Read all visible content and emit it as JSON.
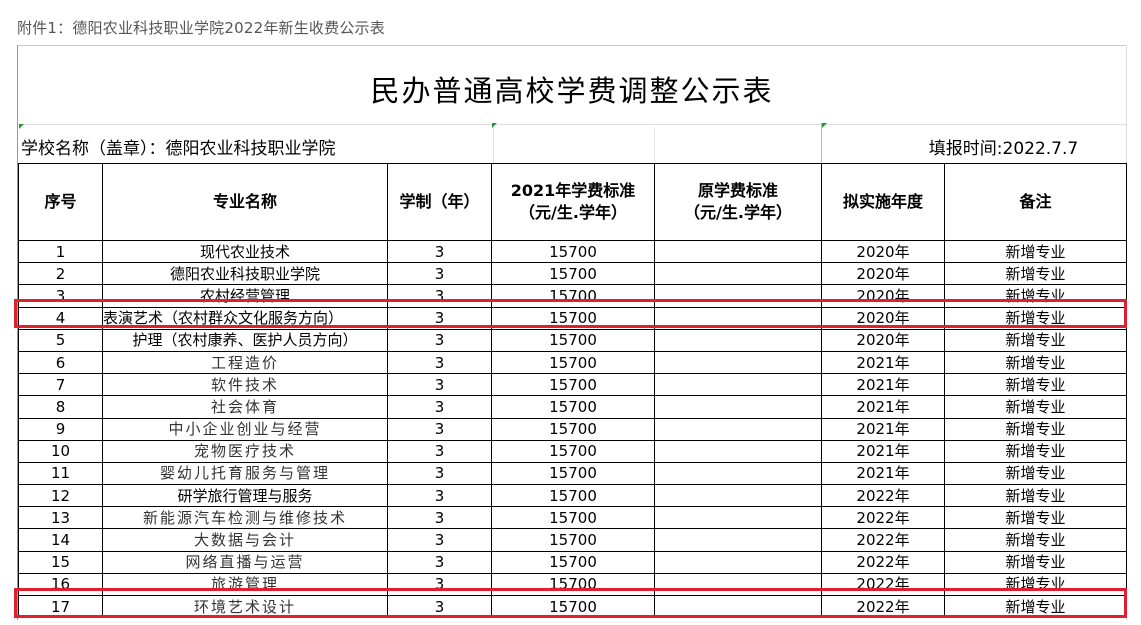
{
  "caption": "附件1：德阳农业科技职业学院2022年新生收费公示表",
  "title": "民办普通高校学费调整公示表",
  "school_label": "学校名称（盖章）：德阳农业科技职业学院",
  "fill_date": "填报时间:2022.7.7",
  "headers": {
    "seq": "序号",
    "major": "专业名称",
    "years": "学制（年）",
    "fee2021_line1": "2021年学费标准",
    "fee2021_line2": "（元/生.学年）",
    "orig_line1": "原学费标准",
    "orig_line2": "（元/生.学年）",
    "impl_year": "拟实施年度",
    "remark": "备注"
  },
  "rows": [
    {
      "seq": "1",
      "major": "现代农业技术",
      "years": "3",
      "fee": "15700",
      "orig": "",
      "year": "2020年",
      "remark": "新增专业"
    },
    {
      "seq": "2",
      "major": "德阳农业科技职业学院",
      "years": "3",
      "fee": "15700",
      "orig": "",
      "year": "2020年",
      "remark": "新增专业"
    },
    {
      "seq": "3",
      "major": "农村经营管理",
      "years": "3",
      "fee": "15700",
      "orig": "",
      "year": "2020年",
      "remark": "新增专业"
    },
    {
      "seq": "4",
      "major": "表演艺术（农村群众文化服务方向）",
      "years": "3",
      "fee": "15700",
      "orig": "",
      "year": "2020年",
      "remark": "新增专业"
    },
    {
      "seq": "5",
      "major": "护理（农村康养、医护人员方向）",
      "years": "3",
      "fee": "15700",
      "orig": "",
      "year": "2020年",
      "remark": "新增专业"
    },
    {
      "seq": "6",
      "major": "工程造价",
      "years": "3",
      "fee": "15700",
      "orig": "",
      "year": "2021年",
      "remark": "新增专业"
    },
    {
      "seq": "7",
      "major": "软件技术",
      "years": "3",
      "fee": "15700",
      "orig": "",
      "year": "2021年",
      "remark": "新增专业"
    },
    {
      "seq": "8",
      "major": "社会体育",
      "years": "3",
      "fee": "15700",
      "orig": "",
      "year": "2021年",
      "remark": "新增专业"
    },
    {
      "seq": "9",
      "major": "中小企业创业与经营",
      "years": "3",
      "fee": "15700",
      "orig": "",
      "year": "2021年",
      "remark": "新增专业"
    },
    {
      "seq": "10",
      "major": "宠物医疗技术",
      "years": "3",
      "fee": "15700",
      "orig": "",
      "year": "2021年",
      "remark": "新增专业"
    },
    {
      "seq": "11",
      "major": "婴幼儿托育服务与管理",
      "years": "3",
      "fee": "15700",
      "orig": "",
      "year": "2021年",
      "remark": "新增专业"
    },
    {
      "seq": "12",
      "major": "研学旅行管理与服务",
      "years": "3",
      "fee": "15700",
      "orig": "",
      "year": "2022年",
      "remark": "新增专业"
    },
    {
      "seq": "13",
      "major": "新能源汽车检测与维修技术",
      "years": "3",
      "fee": "15700",
      "orig": "",
      "year": "2022年",
      "remark": "新增专业"
    },
    {
      "seq": "14",
      "major": "大数据与会计",
      "years": "3",
      "fee": "15700",
      "orig": "",
      "year": "2022年",
      "remark": "新增专业"
    },
    {
      "seq": "15",
      "major": "网络直播与运营",
      "years": "3",
      "fee": "15700",
      "orig": "",
      "year": "2022年",
      "remark": "新增专业"
    },
    {
      "seq": "16",
      "major": "旅游管理",
      "years": "3",
      "fee": "15700",
      "orig": "",
      "year": "2022年",
      "remark": "新增专业"
    },
    {
      "seq": "17",
      "major": "环境艺术设计",
      "years": "3",
      "fee": "15700",
      "orig": "",
      "year": "2022年",
      "remark": "新增专业"
    }
  ],
  "colors": {
    "highlight": "#e0202e",
    "cell_marker": "#1a9b3a"
  }
}
